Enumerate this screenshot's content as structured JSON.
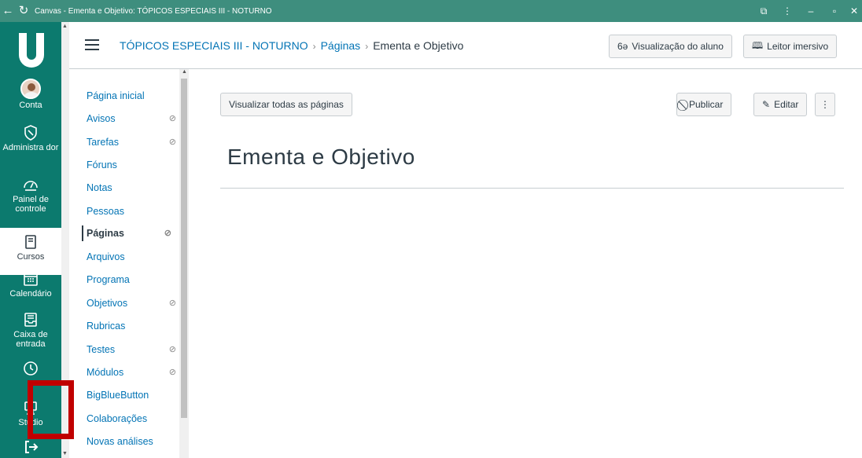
{
  "window": {
    "title": "Canvas - Ementa e Objetivo: TÓPICOS ESPECIAIS III - NOTURNO"
  },
  "global_nav": {
    "items": [
      {
        "label": "Conta",
        "icon": "avatar"
      },
      {
        "label": "Administra dor",
        "icon": "shield-icon"
      },
      {
        "label": "Painel de controle",
        "icon": "dashboard-icon"
      },
      {
        "label": "Cursos",
        "icon": "book-icon"
      },
      {
        "label": "Calendário",
        "icon": "calendar-icon"
      },
      {
        "label": "Caixa de entrada",
        "icon": "inbox-icon"
      },
      {
        "label": "",
        "icon": "clock-icon"
      },
      {
        "label": "Studio",
        "icon": "studio-icon"
      },
      {
        "label": "",
        "icon": "logout-icon"
      }
    ],
    "highlight_color": "#c00000"
  },
  "header": {
    "breadcrumb": {
      "course": "TÓPICOS ESPECIAIS III - NOTURNO",
      "section": "Páginas",
      "current": "Ementa e Objetivo"
    },
    "student_view_label": "Visualização do aluno",
    "immersive_reader_label": "Leitor imersivo"
  },
  "course_nav": {
    "items": [
      {
        "label": "Página inicial",
        "hidden": false
      },
      {
        "label": "Avisos",
        "hidden": true
      },
      {
        "label": "Tarefas",
        "hidden": true
      },
      {
        "label": "Fóruns",
        "hidden": false
      },
      {
        "label": "Notas",
        "hidden": false
      },
      {
        "label": "Pessoas",
        "hidden": false
      },
      {
        "label": "Páginas",
        "hidden": true,
        "active": true
      },
      {
        "label": "Arquivos",
        "hidden": false
      },
      {
        "label": "Programa",
        "hidden": false
      },
      {
        "label": "Objetivos",
        "hidden": true
      },
      {
        "label": "Rubricas",
        "hidden": false
      },
      {
        "label": "Testes",
        "hidden": true
      },
      {
        "label": "Módulos",
        "hidden": true
      },
      {
        "label": "BigBlueButton",
        "hidden": false
      },
      {
        "label": "Colaborações",
        "hidden": false
      },
      {
        "label": "Novas análises",
        "hidden": false
      }
    ]
  },
  "main": {
    "view_all_label": "Visualizar todas as páginas",
    "publish_label": "Publicar",
    "edit_label": "Editar",
    "page_title": "Ementa e Objetivo"
  },
  "colors": {
    "titlebar": "#3e8e7e",
    "global_nav": "#0c7a6e",
    "link": "#0374b5"
  }
}
